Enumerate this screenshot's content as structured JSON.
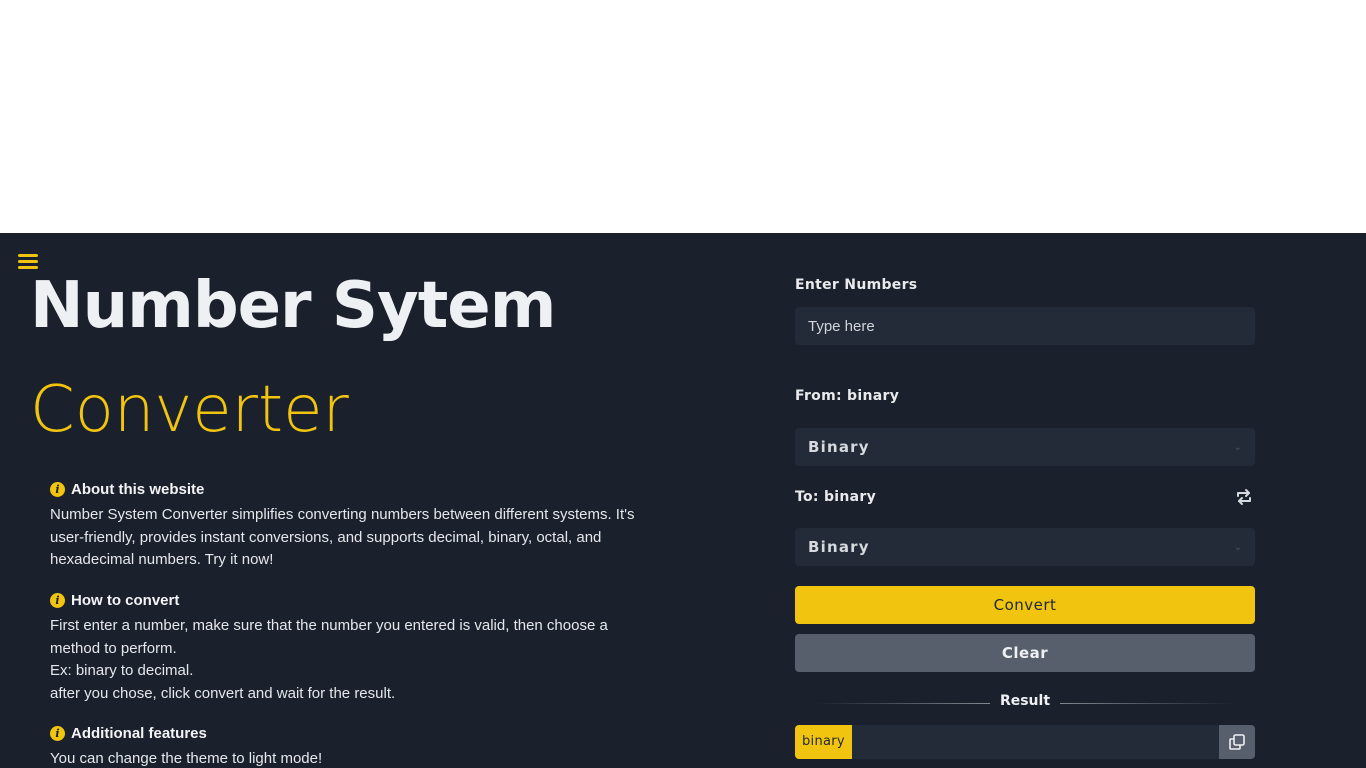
{
  "hero": {
    "title_line1": "Number Sytem",
    "title_line2": "Converter"
  },
  "info": [
    {
      "heading": "About this website",
      "lines": [
        "Number System Converter simplifies converting numbers between different systems. It's user-friendly, provides instant conversions, and supports decimal, binary, octal, and hexadecimal numbers. Try it now!"
      ]
    },
    {
      "heading": "How to convert",
      "lines": [
        "First enter a number, make sure that the number you entered is valid, then choose a method to perform.",
        "Ex: binary to decimal.",
        "after you chose, click convert and wait for the result."
      ]
    },
    {
      "heading": "Additional features",
      "lines": [
        "You can change the theme to light mode!"
      ]
    }
  ],
  "form": {
    "enter_label": "Enter Numbers",
    "input_placeholder": "Type here",
    "input_value": "",
    "from_label": "From: binary",
    "from_selected": "Binary",
    "to_label": "To: binary",
    "to_selected": "Binary",
    "convert_label": "Convert",
    "clear_label": "Clear",
    "result_label": "Result",
    "result_badge": "binary",
    "result_value": ""
  },
  "icons": {
    "menu": "hamburger-menu-icon",
    "info": "info-icon",
    "swap": "swap-arrows-icon",
    "copy": "copy-icon",
    "chevron": "chevron-down-icon"
  },
  "colors": {
    "accent": "#f1c40f",
    "background": "#1a202c",
    "field": "#222b37",
    "secondary_button": "#565f6b"
  }
}
